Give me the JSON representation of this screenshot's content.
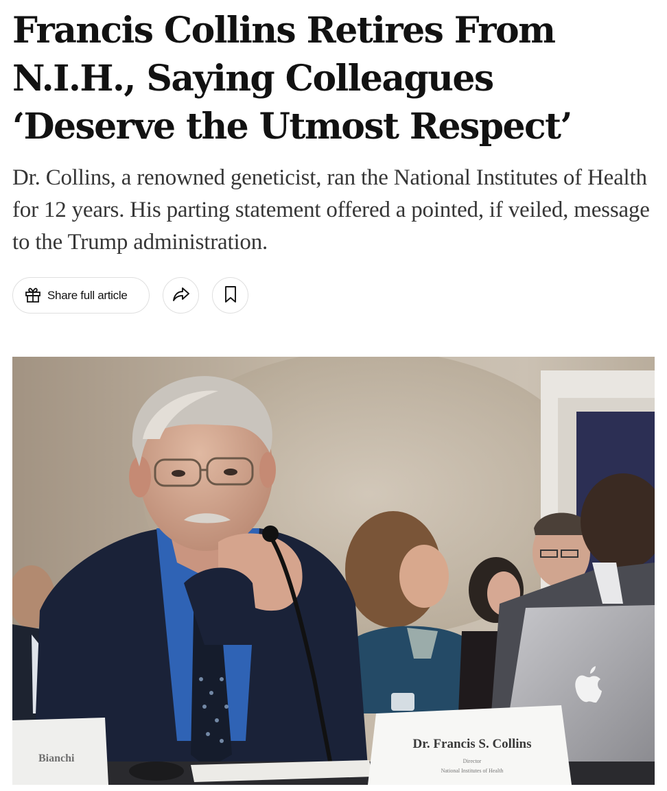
{
  "article": {
    "headline": "Francis Collins Retires From N.I.H., Saying Colleagues ‘Deserve the Utmost Respect’",
    "summary": "Dr. Collins, a renowned geneticist, ran the National Institutes of Health for 12 years. His parting statement offered a pointed, if veiled, message to the Trump administration."
  },
  "actions": {
    "share_label": "Share full article",
    "share_icon": "gift-icon",
    "forward_icon": "share-arrow-icon",
    "save_icon": "bookmark-icon"
  },
  "photo": {
    "nameplate_name": "Dr. Francis S. Collins",
    "nameplate_title": "Director",
    "nameplate_org": "National Institutes of Health",
    "left_nameplate": "Bianchi"
  },
  "colors": {
    "text": "#121212",
    "summary_text": "#363636",
    "button_border": "#dfdfdf"
  }
}
